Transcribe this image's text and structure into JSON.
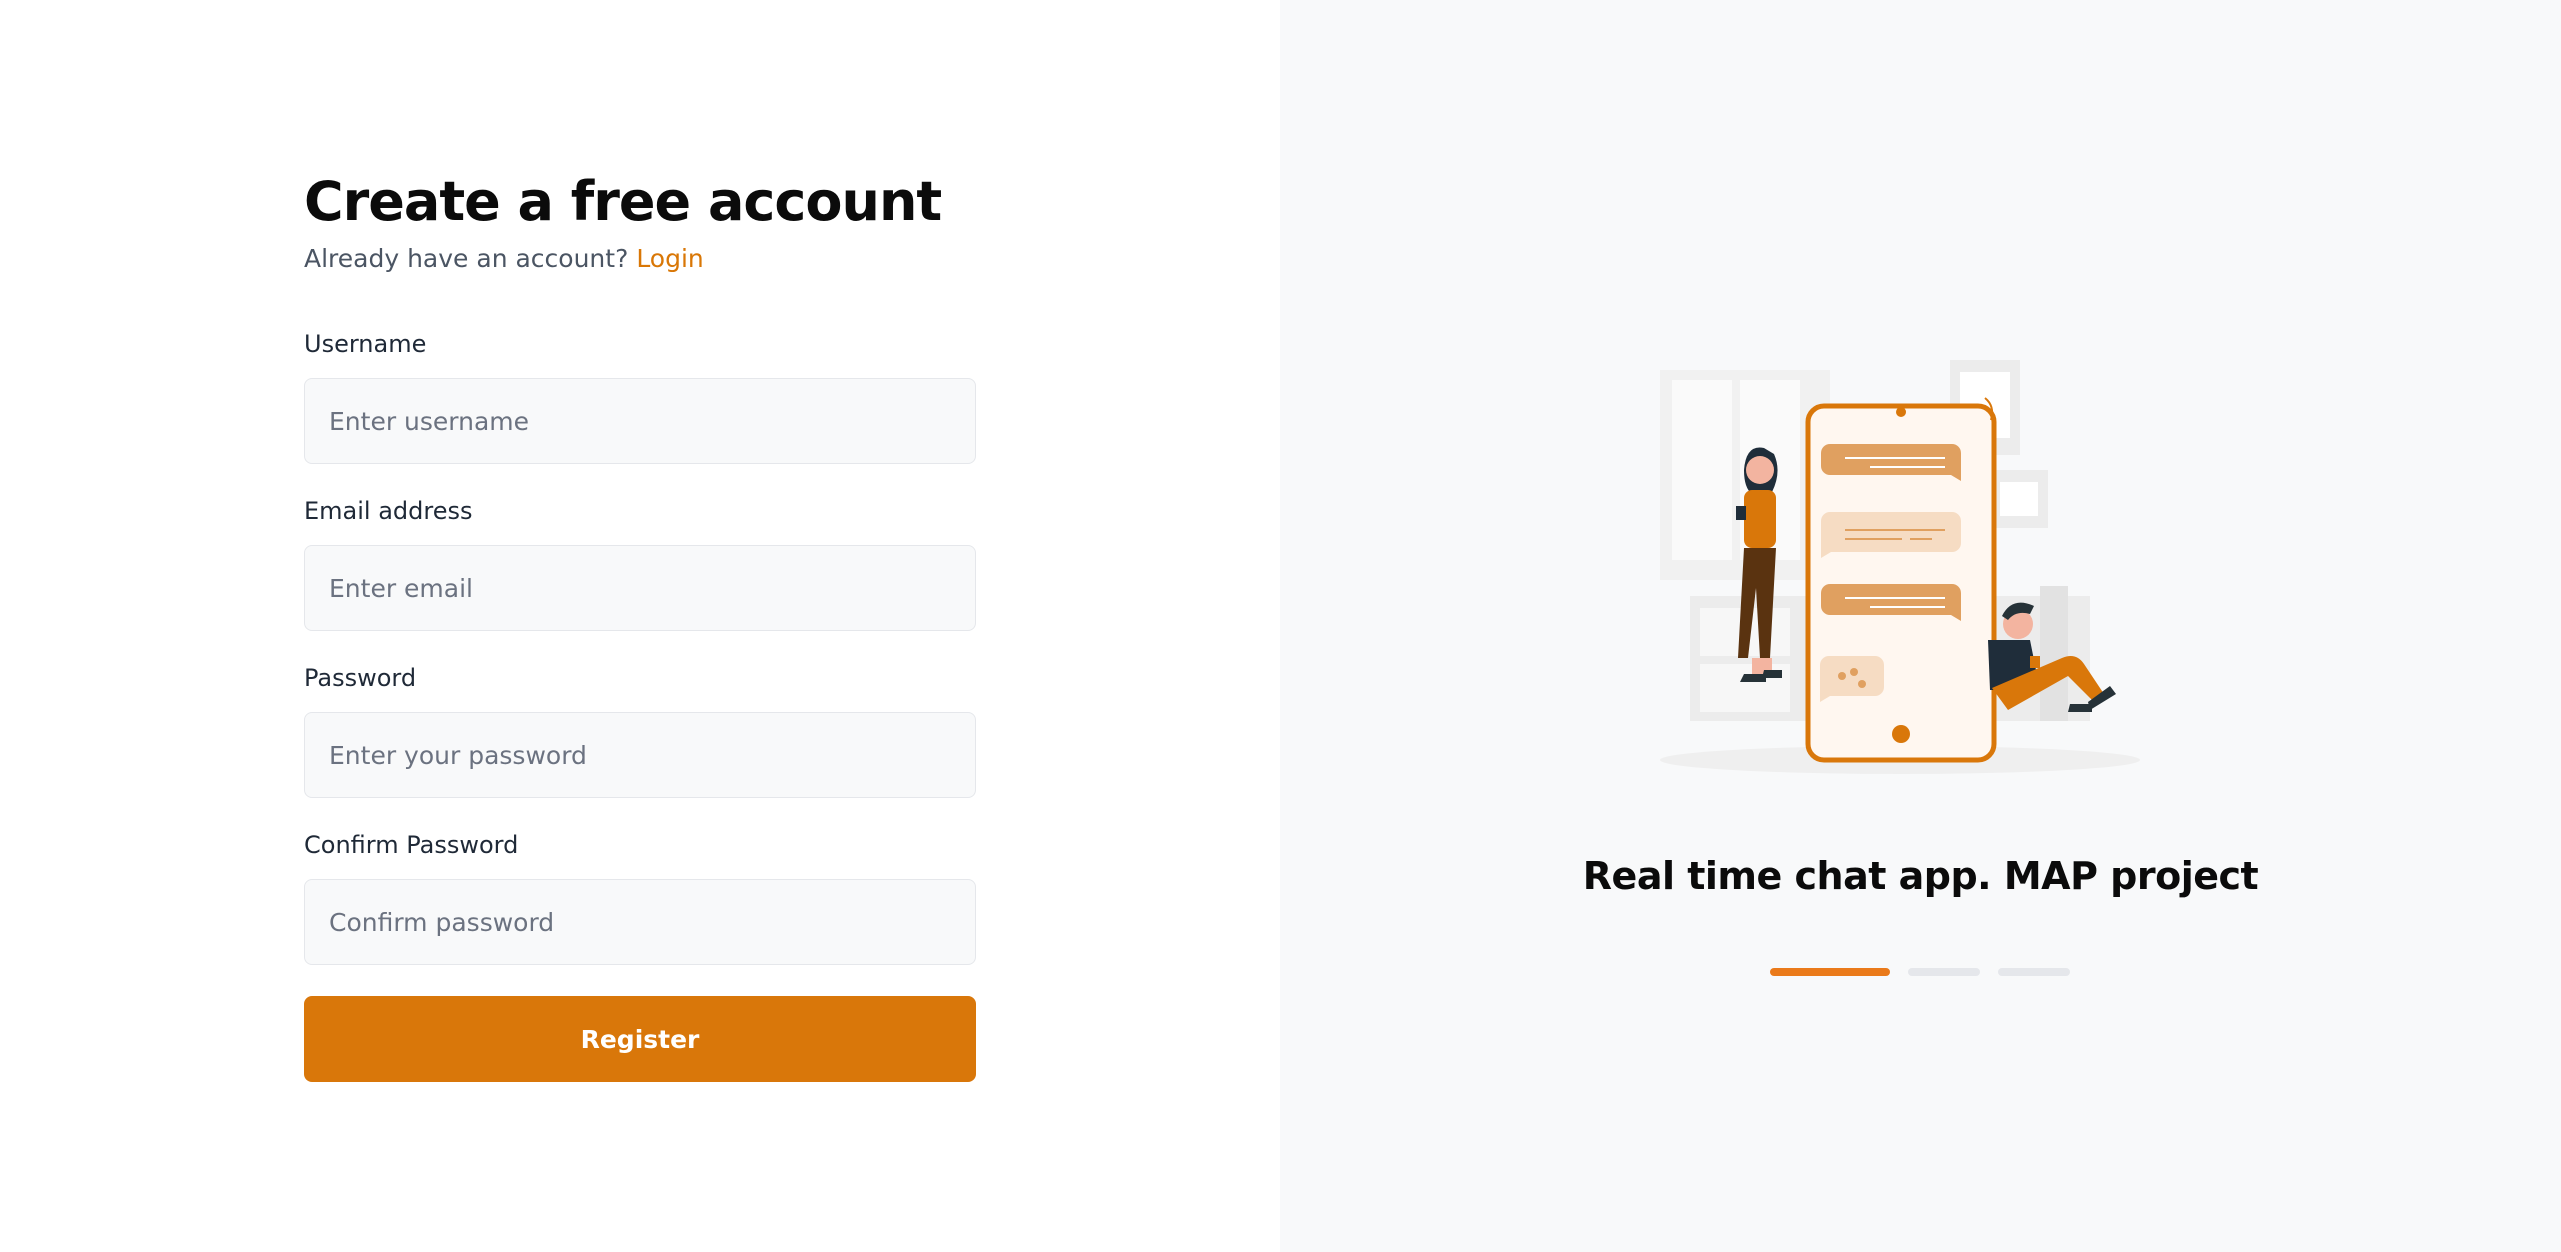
{
  "form": {
    "title": "Create a free account",
    "subtitle_text": "Already have an account?",
    "login_link": "Login",
    "fields": {
      "username": {
        "label": "Username",
        "placeholder": "Enter username",
        "value": ""
      },
      "email": {
        "label": "Email address",
        "placeholder": "Enter email",
        "value": ""
      },
      "password": {
        "label": "Password",
        "placeholder": "Enter your password",
        "value": ""
      },
      "confirm_password": {
        "label": "Confirm Password",
        "placeholder": "Confirm password",
        "value": ""
      }
    },
    "register_label": "Register"
  },
  "showcase": {
    "tagline": "Real time chat app. MAP project",
    "slides": {
      "count": 3,
      "active_index": 0
    },
    "illustration_icon": "chat-illustration"
  },
  "colors": {
    "accent": "#d9770a",
    "indicator_active": "#ea7a1a",
    "indicator_inactive": "#e5e7eb",
    "right_panel_bg": "#f8f9fa",
    "input_bg": "#f8f9fa"
  }
}
